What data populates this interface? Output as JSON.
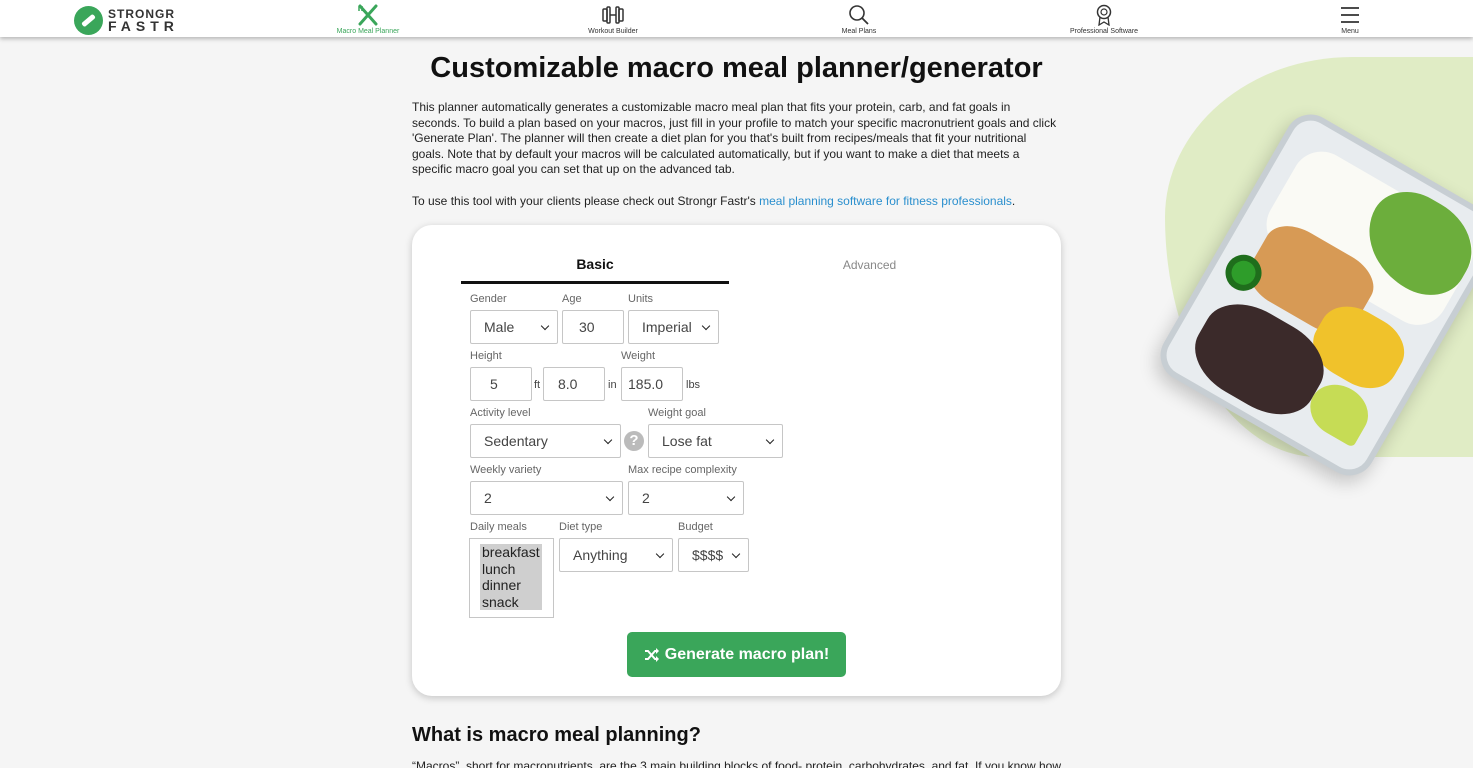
{
  "nav": {
    "logo_top": "STRONGR",
    "logo_bottom": "FASTR",
    "items": [
      {
        "label": "Macro Meal Planner",
        "icon": "fork-knife-icon",
        "active": true
      },
      {
        "label": "Workout Builder",
        "icon": "dumbbell-icon",
        "active": false
      },
      {
        "label": "Meal Plans",
        "icon": "search-icon",
        "active": false
      },
      {
        "label": "Professional Software",
        "icon": "award-icon",
        "active": false
      },
      {
        "label": "Menu",
        "icon": "hamburger-menu-icon",
        "active": false
      }
    ]
  },
  "page": {
    "title": "Customizable macro meal planner/generator",
    "intro": "This planner automatically generates a customizable macro meal plan that fits your protein, carb, and fat goals in seconds. To build a plan based on your macros, just fill in your profile to match your specific macronutrient goals and click 'Generate Plan'. The planner will then create a diet plan for you that's built from recipes/meals that fit your nutritional goals. Note that by default your macros will be calculated automatically, but if you want to make a diet that meets a specific macro goal you can set that up on the advanced tab.",
    "clients_prefix": "To use this tool with your clients please check out Strongr Fastr's ",
    "clients_link": "meal planning software for fitness professionals",
    "clients_suffix": "."
  },
  "form": {
    "tabs": {
      "basic": "Basic",
      "advanced": "Advanced"
    },
    "gender": {
      "label": "Gender",
      "value": "Male"
    },
    "age": {
      "label": "Age",
      "value": "30"
    },
    "units": {
      "label": "Units",
      "value": "Imperial"
    },
    "height": {
      "label": "Height",
      "feet": "5",
      "feet_unit": "ft",
      "inches": "8.0",
      "inches_unit": "in"
    },
    "weight": {
      "label": "Weight",
      "value": "185.0",
      "unit": "lbs"
    },
    "activity": {
      "label": "Activity level",
      "value": "Sedentary"
    },
    "weight_goal": {
      "label": "Weight goal",
      "value": "Lose fat"
    },
    "weekly_variety": {
      "label": "Weekly variety",
      "value": "2"
    },
    "max_complexity": {
      "label": "Max recipe complexity",
      "value": "2"
    },
    "daily_meals": {
      "label": "Daily meals",
      "options": [
        "breakfast",
        "lunch",
        "dinner",
        "snack"
      ]
    },
    "diet_type": {
      "label": "Diet type",
      "value": "Anything"
    },
    "budget": {
      "label": "Budget",
      "value": "$$$$"
    },
    "generate_label": "Generate macro plan!"
  },
  "section": {
    "heading": "What is macro meal planning?",
    "paragraph": "“Macros”, short for macronutrients, are the 3 main building blocks of food- protein, carbohydrates, and fat. If you know how many"
  },
  "colors": {
    "accent": "#3aa65a",
    "link": "#2a8fce"
  }
}
